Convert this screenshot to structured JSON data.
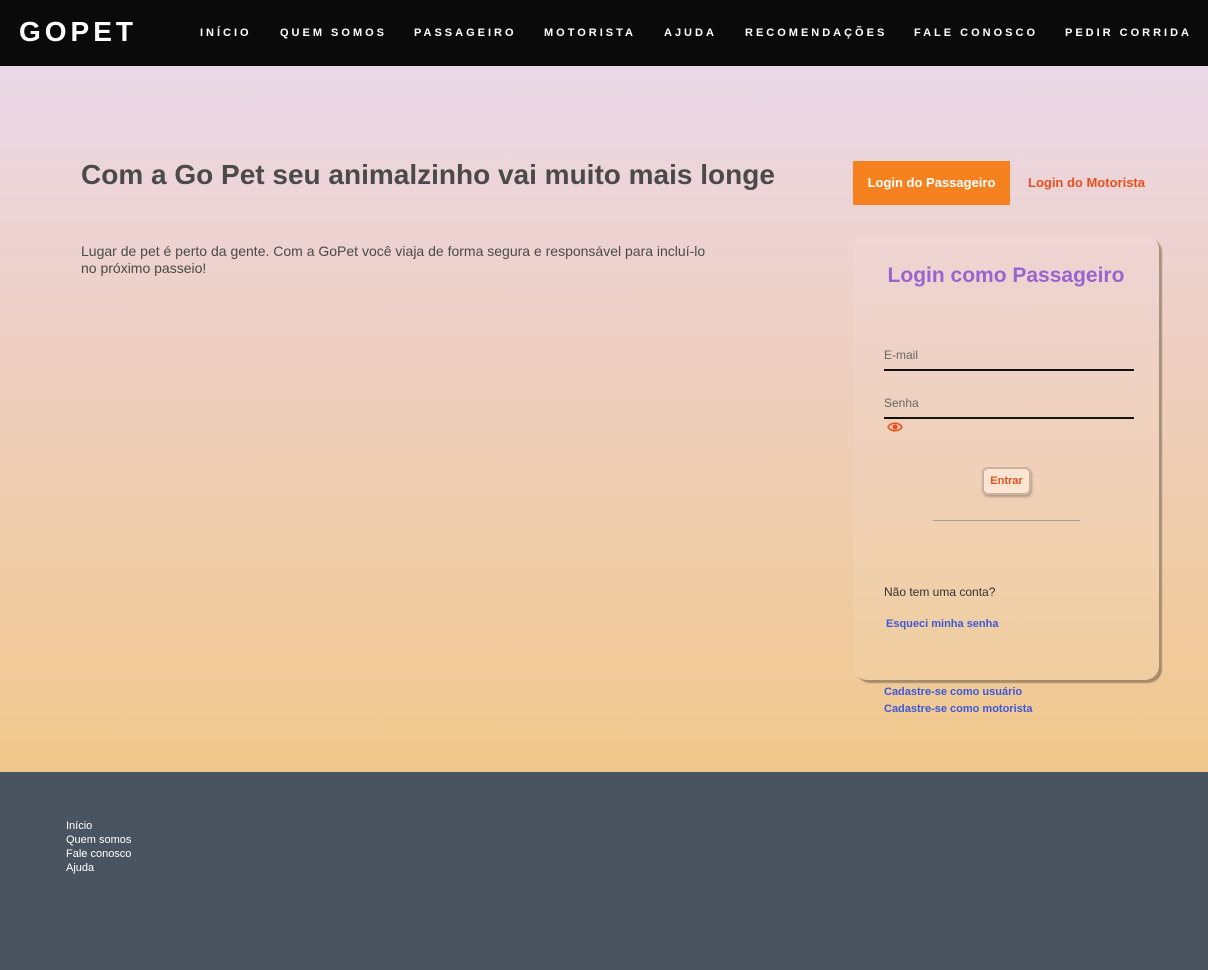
{
  "nav": {
    "brand": "GOPET",
    "items": [
      {
        "label": "INÍCIO"
      },
      {
        "label": "QUEM SOMOS"
      },
      {
        "label": "PASSAGEIRO"
      },
      {
        "label": "MOTORISTA"
      },
      {
        "label": "AJUDA"
      },
      {
        "label": "RECOMENDAÇÕES"
      },
      {
        "label": "FALE CONOSCO"
      },
      {
        "label": "PEDIR CORRIDA"
      }
    ]
  },
  "hero": {
    "title": "Com a Go Pet seu animalzinho vai muito mais longe",
    "text": "Lugar de pet é perto da gente. Com a GoPet você viaja de forma segura e responsável para incluí-lo no próximo passeio!"
  },
  "tabs": {
    "passenger": "Login do Passageiro",
    "driver": "Login do Motorista"
  },
  "login": {
    "title": "Login como Passageiro",
    "email_placeholder": "E-mail",
    "password_placeholder": "Senha",
    "submit": "Entrar",
    "forgot": "Esqueci minha senha",
    "no_account": "Não tem uma conta?",
    "signup_user": "Cadastre-se como usuário",
    "signup_driver": "Cadastre-se como motorista"
  },
  "footer": {
    "links": [
      {
        "label": "Início"
      },
      {
        "label": "Quem somos"
      },
      {
        "label": "Fale conosco"
      },
      {
        "label": "Ajuda"
      }
    ]
  },
  "colors": {
    "navbar": "#0a0a0a",
    "accent_orange": "#f5821f",
    "link_orange": "#e8501e",
    "title_purple": "#9b63cf",
    "link_blue": "#3d59d9",
    "footer": "#4a5360"
  },
  "icons": {
    "password_toggle": "eye-icon"
  }
}
